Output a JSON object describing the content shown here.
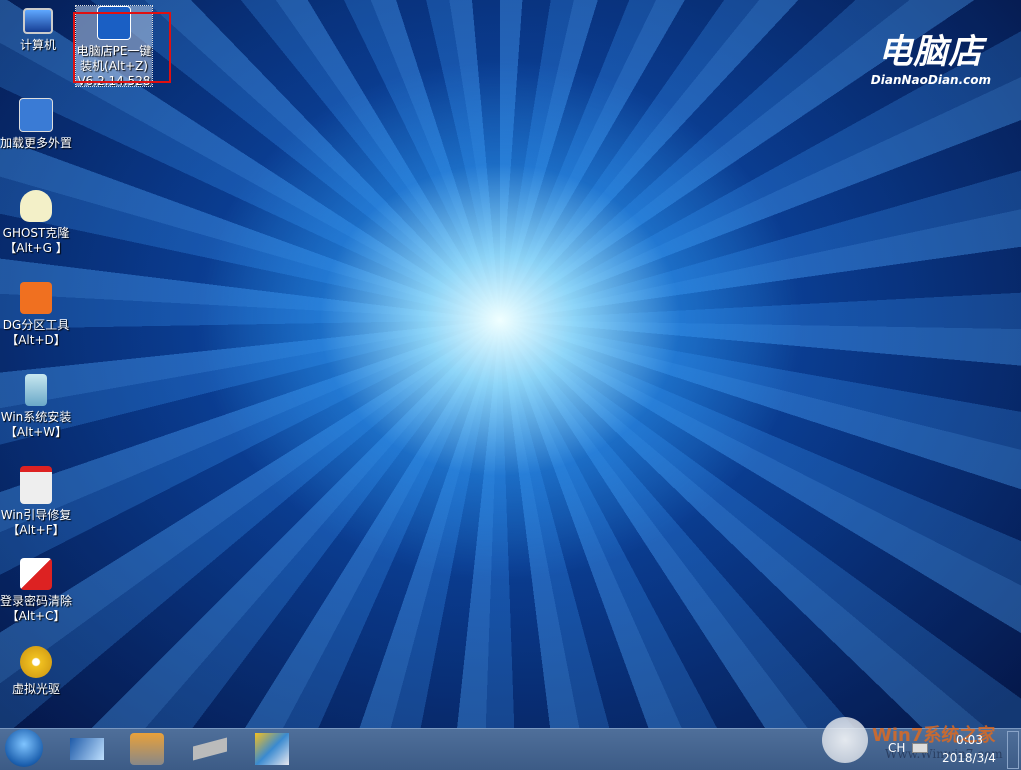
{
  "desktop": {
    "icons": [
      {
        "label": "计算机",
        "icon": "computer-icon"
      },
      {
        "label": "电脑店PE一键装机(Alt+Z) V6.2.14.528",
        "icon": "installer-icon",
        "selected": true
      },
      {
        "label": "加载更多外置",
        "icon": "load-more-icon"
      },
      {
        "label": "GHOST克隆【Alt+G 】",
        "icon": "ghost-icon"
      },
      {
        "label": "DG分区工具【Alt+D】",
        "icon": "diskgenius-icon"
      },
      {
        "label": "Win系统安装【Alt+W】",
        "icon": "win-install-icon"
      },
      {
        "label": "Win引导修复【Alt+F】",
        "icon": "boot-repair-icon"
      },
      {
        "label": "登录密码清除【Alt+C】",
        "icon": "password-clear-icon"
      },
      {
        "label": "虚拟光驱",
        "icon": "virtual-drive-icon"
      }
    ]
  },
  "logo": {
    "cn": "电脑店",
    "en": "DianNaoDian.com"
  },
  "taskbar": {
    "pinned": [
      "desktop-icon",
      "cleanup-icon",
      "memory-icon",
      "tools-icon"
    ],
    "lang": "CH",
    "time": "0:03",
    "date": "2018/3/4"
  },
  "watermark": {
    "text": "Win7系统之家",
    "url": "Www.Winwin7.com"
  },
  "colors": {
    "highlight": "#e01010"
  }
}
